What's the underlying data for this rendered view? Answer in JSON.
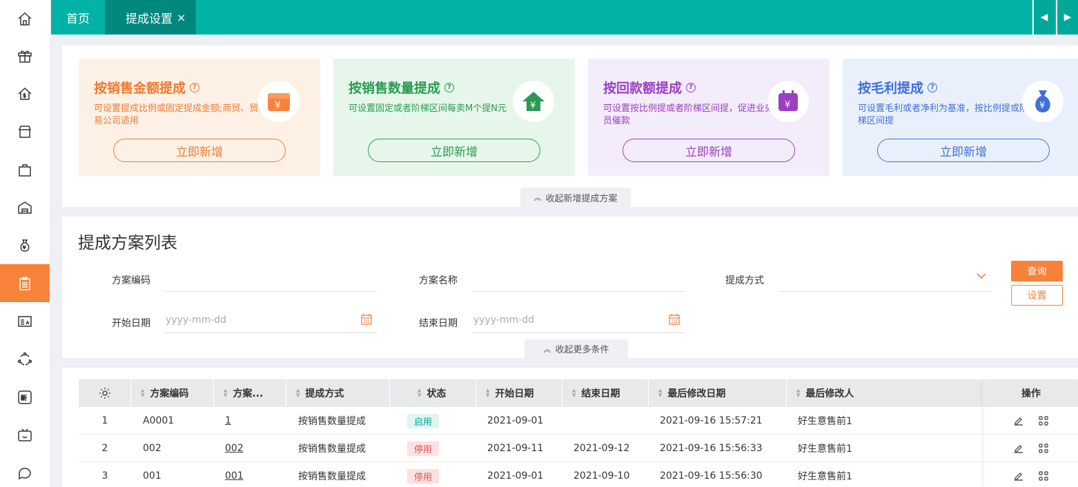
{
  "topbar": {
    "home_tab": "首页",
    "active_tab": "提成设置",
    "close_glyph": "×",
    "nav_prev": "◀",
    "nav_next": "▶"
  },
  "sidebar": {
    "items": [
      {
        "icon": "home-icon"
      },
      {
        "icon": "gift-icon"
      },
      {
        "icon": "money-house-icon"
      },
      {
        "icon": "store-icon"
      },
      {
        "icon": "shopping-bag-icon"
      },
      {
        "icon": "warehouse-icon"
      },
      {
        "icon": "money-bag-icon"
      },
      {
        "icon": "clipboard-icon",
        "active": true
      },
      {
        "icon": "id-card-icon"
      },
      {
        "icon": "cycle-icon"
      },
      {
        "icon": "new-badge-icon"
      },
      {
        "icon": "tv-icon"
      },
      {
        "icon": "chat-icon"
      }
    ]
  },
  "cards": [
    {
      "title": "按销售金额提成",
      "desc": "可设置提成比例或固定提成金额;商贸、贸易公司适用",
      "button": "立即新增",
      "color": "#f07a32",
      "bg": "#fdf1e6",
      "icon": "wallet-icon"
    },
    {
      "title": "按销售数量提成",
      "desc": "可设置固定或者阶梯区间每卖M个提N元",
      "button": "立即新增",
      "color": "#2a9a52",
      "bg": "#e6f6ea",
      "icon": "money-house-icon"
    },
    {
      "title": "按回款额提成",
      "desc": "可设置按比例提或者阶梯区间提，促进业务员催款",
      "button": "立即新增",
      "color": "#9a3fc0",
      "bg": "#f3ecfa",
      "icon": "calendar-money-icon"
    },
    {
      "title": "按毛利提成",
      "desc": "可设置毛利或者净利为基准，按比例提或阶梯区间提",
      "button": "立即新增",
      "color": "#3f6fd8",
      "bg": "#eaf0fb",
      "icon": "money-bag-icon"
    }
  ],
  "collapse_cards_label": "收起新增提成方案",
  "filter": {
    "title": "提成方案列表",
    "code_label": "方案编码",
    "name_label": "方案名称",
    "method_label": "提成方式",
    "start_label": "开始日期",
    "end_label": "结束日期",
    "date_placeholder": "yyyy-mm-dd",
    "query_button": "查询",
    "settings_button": "设置",
    "collapse_more": "收起更多条件"
  },
  "table": {
    "columns": [
      "方案编码",
      "方案...",
      "提成方式",
      "状态",
      "开始日期",
      "结束日期",
      "最后修改日期",
      "最后修改人"
    ],
    "ops_header": "操作",
    "rows": [
      {
        "index": "1",
        "code": "A0001",
        "name": "1",
        "method": "按销售数量提成",
        "status": "启用",
        "active": true,
        "start": "2021-09-01",
        "end": "",
        "modified": "2021-09-16 15:57:21",
        "modifier": "好生意售前1"
      },
      {
        "index": "2",
        "code": "002",
        "name": "002",
        "method": "按销售数量提成",
        "status": "停用",
        "active": false,
        "start": "2021-09-11",
        "end": "2021-09-12",
        "modified": "2021-09-16 15:56:33",
        "modifier": "好生意售前1"
      },
      {
        "index": "3",
        "code": "001",
        "name": "001",
        "method": "按销售数量提成",
        "status": "停用",
        "active": false,
        "start": "2021-09-01",
        "end": "2021-09-10",
        "modified": "2021-09-16 15:56:30",
        "modifier": "好生意售前1"
      }
    ]
  },
  "colors": {
    "teal": "#00b3a4",
    "orange": "#f7823a"
  }
}
